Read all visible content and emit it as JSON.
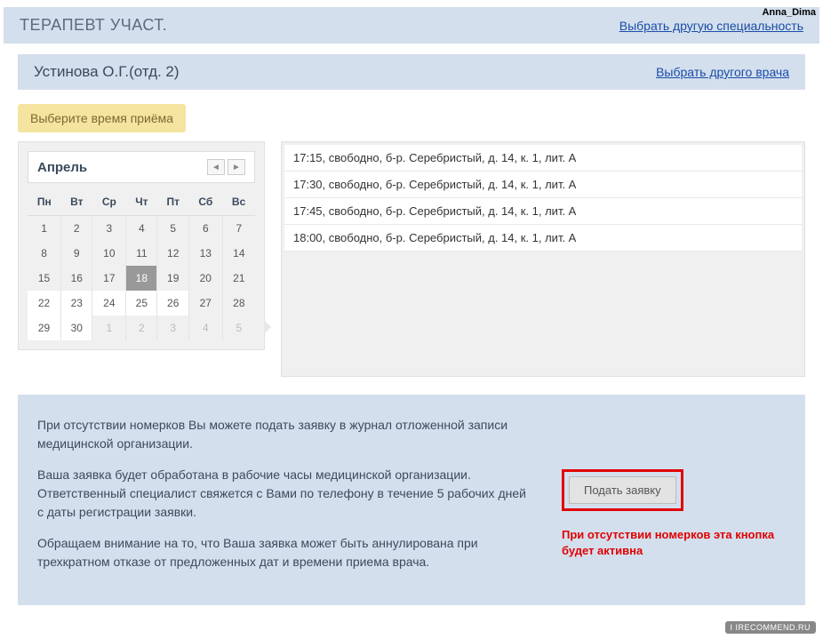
{
  "watermark_top": "Anna_Dima",
  "watermark_bottom": "I IRECOMMEND.RU",
  "header": {
    "title": "ТЕРАПЕВТ УЧАСТ.",
    "link": "Выбрать другую специальность"
  },
  "doctor": {
    "name": "Устинова О.Г.(отд. 2)",
    "link": "Выбрать другого врача"
  },
  "prompt": "Выберите время приёма",
  "calendar": {
    "month": "Апрель",
    "prev": "◄",
    "next": "►",
    "dow": [
      "Пн",
      "Вт",
      "Ср",
      "Чт",
      "Пт",
      "Сб",
      "Вс"
    ],
    "weeks": [
      [
        {
          "d": "1"
        },
        {
          "d": "2"
        },
        {
          "d": "3"
        },
        {
          "d": "4"
        },
        {
          "d": "5"
        },
        {
          "d": "6"
        },
        {
          "d": "7"
        }
      ],
      [
        {
          "d": "8"
        },
        {
          "d": "9"
        },
        {
          "d": "10"
        },
        {
          "d": "11"
        },
        {
          "d": "12"
        },
        {
          "d": "13"
        },
        {
          "d": "14"
        }
      ],
      [
        {
          "d": "15"
        },
        {
          "d": "16"
        },
        {
          "d": "17"
        },
        {
          "d": "18",
          "sel": true
        },
        {
          "d": "19"
        },
        {
          "d": "20"
        },
        {
          "d": "21"
        }
      ],
      [
        {
          "d": "22",
          "avail": true
        },
        {
          "d": "23",
          "avail": true
        },
        {
          "d": "24",
          "avail": true
        },
        {
          "d": "25",
          "avail": true
        },
        {
          "d": "26",
          "avail": true
        },
        {
          "d": "27"
        },
        {
          "d": "28"
        }
      ],
      [
        {
          "d": "29",
          "avail": true
        },
        {
          "d": "30",
          "avail": true
        },
        {
          "d": "1",
          "dim": true
        },
        {
          "d": "2",
          "dim": true
        },
        {
          "d": "3",
          "dim": true
        },
        {
          "d": "4",
          "dim": true
        },
        {
          "d": "5",
          "dim": true
        }
      ]
    ]
  },
  "slots": [
    "17:15, свободно, б-р. Серебристый, д. 14, к. 1, лит. А",
    "17:30, свободно, б-р. Серебристый, д. 14, к. 1, лит. А",
    "17:45, свободно, б-р. Серебристый, д. 14, к. 1, лит. А",
    "18:00, свободно, б-р. Серебристый, д. 14, к. 1, лит. А"
  ],
  "footer": {
    "p1": "При отсутствии номерков Вы можете подать заявку в журнал отложенной записи медицинской организации.",
    "p2": "Ваша заявка будет обработана в рабочие часы медицинской организации. Ответственный специалист свяжется с Вами по телефону в течение 5 рабочих дней с даты регистрации заявки.",
    "p3": "Обращаем внимание на то, что Ваша заявка может быть аннулирована при трехкратном отказе от предложенных дат и времени приема врача.",
    "button": "Подать заявку",
    "note": "При отсутствии номерков эта кнопка будет активна"
  }
}
